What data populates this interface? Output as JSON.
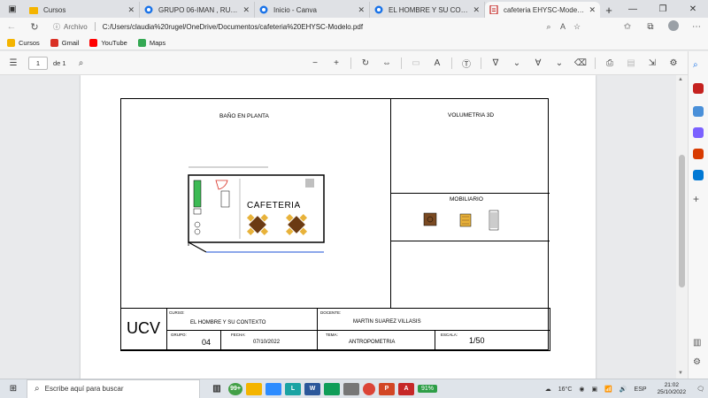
{
  "browser": {
    "tabs": [
      {
        "label": "Cursos",
        "favicon_color": "#f4b400",
        "active": false
      },
      {
        "label": "GRUPO 06-IMAN , RUGEL - F",
        "favicon_color": "#1a73e8",
        "active": false
      },
      {
        "label": "Inicio - Canva",
        "favicon_color": "#1a73e8",
        "active": false
      },
      {
        "label": "EL HOMBRE Y SU CONTEXTO",
        "favicon_color": "#1a73e8",
        "active": false
      },
      {
        "label": "cafeteria EHYSC-Modelo.pdf",
        "favicon_color": "#c5221f",
        "active": true
      }
    ],
    "address": {
      "scheme_label": "Archivo",
      "url": "C:/Users/claudia%20rugel/OneDrive/Documentos/cafeteria%20EHYSC-Modelo.pdf"
    },
    "bookmarks": [
      {
        "label": "Cursos",
        "color": "#f4b400"
      },
      {
        "label": "Gmail",
        "color": "#d93025"
      },
      {
        "label": "YouTube",
        "color": "#ff0000"
      },
      {
        "label": "Maps",
        "color": "#34a853"
      }
    ]
  },
  "pdf_toolbar": {
    "page_current": "1",
    "page_total_label": "de 1"
  },
  "document": {
    "plan_title": "BAÑO EN PLANTA",
    "volumetry_title": "VOLUMETRIA 3D",
    "furniture_title": "MOBILIARIO",
    "cafeteria_label": "CAFETERIA",
    "ucv": "UCV",
    "curso_label": "CURSO:",
    "curso_value": "EL HOMBRE Y SU CONTEXTO",
    "docente_label": "DOCENTE:",
    "docente_value": "MARTIN SUAREZ VILLASIS",
    "grupo_label": "GRUPO:",
    "grupo_value": "04",
    "fecha_label": "FECHA:",
    "fecha_value": "07/10/2022",
    "tema_label": "TEMA:",
    "tema_value": "ANTROPOMETRIA",
    "escala_label": "ESCALA:",
    "escala_value": "1/50"
  },
  "taskbar": {
    "search_placeholder": "Escribe aquí para buscar",
    "battery": "91%",
    "weather": "16°C",
    "language": "ESP",
    "time": "21:02",
    "date": "25/10/2022",
    "notification_badge": "99+"
  }
}
